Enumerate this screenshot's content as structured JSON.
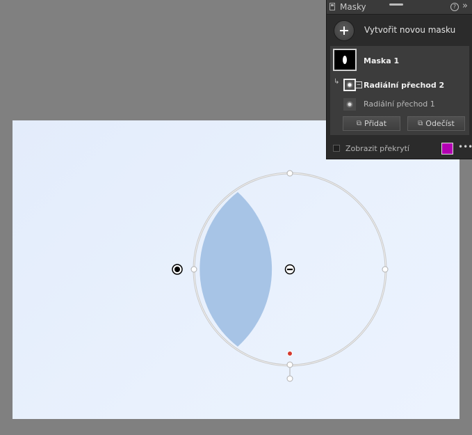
{
  "panel": {
    "title": "Masky",
    "help_glyph": "?",
    "collapse_glyph": "»",
    "new_mask_label": "Vytvořit novou masku",
    "masks": [
      {
        "name": "Maska 1",
        "components": [
          {
            "name": "Radiální přechod 2",
            "selected": true
          },
          {
            "name": "Radiální přechod 1",
            "selected": false
          }
        ]
      }
    ],
    "add_label": "Přidat",
    "subtract_label": "Odečíst",
    "overlay_label": "Zobrazit překrytí",
    "overlay_checked": false,
    "overlay_color": "#b300b3",
    "more_glyph": "•••"
  },
  "colors": {
    "mask_overlay": "#a7c4e6",
    "canvas_bg": "#e8f0fd",
    "app_bg": "#808080"
  },
  "icons": [
    "panel-icon",
    "help-icon",
    "collapse-icon",
    "plus-icon",
    "mask-thumbnail",
    "radial-gradient-icon",
    "child-arrow-icon",
    "add-icon",
    "subtract-icon",
    "more-icon"
  ]
}
